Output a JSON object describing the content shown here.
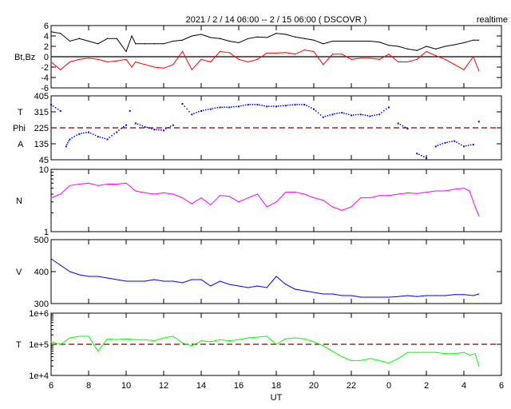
{
  "chart_data": {
    "type": "line",
    "title": "2021 / 2 / 14   06:00 --  2 / 15   06:00 ( DSCOVR )",
    "mode_label": "realtime",
    "xlabel": "UT",
    "x_unit": "hours since 2021-02-14 00:00",
    "xlim": [
      6,
      30
    ],
    "xticks": [
      6,
      8,
      10,
      12,
      14,
      16,
      18,
      20,
      22,
      24,
      26,
      28,
      30
    ],
    "xtick_labels": [
      "6",
      "8",
      "10",
      "12",
      "14",
      "16",
      "18",
      "20",
      "22",
      "0",
      "2",
      "4",
      "6"
    ],
    "colors": {
      "bt": "#000000",
      "bz": "#ff0000",
      "phi": "#0000ff",
      "n": "#ff00ff",
      "v": "#0000ff",
      "t": "#00ff00",
      "ref": "#800000"
    },
    "panels": [
      {
        "id": "bt-bz",
        "ylabel": "Bt,Bz",
        "scale": "linear",
        "ylim": [
          -6,
          6
        ],
        "yticks": [
          -6,
          -4,
          -2,
          0,
          2,
          4,
          6
        ],
        "ytick_labels": [
          "-6",
          "-4",
          "-2",
          "0",
          "2",
          "4",
          "6"
        ],
        "ref_line": {
          "value": 0,
          "style": "solid"
        },
        "series": [
          {
            "name": "Bt",
            "color_key": "bt",
            "x": [
              6,
              6.5,
              7,
              7.5,
              8,
              8.5,
              9,
              9.5,
              10,
              10.3,
              10.5,
              11,
              11.5,
              12,
              12.5,
              13,
              13.5,
              14,
              14.5,
              15,
              15.5,
              16,
              16.5,
              17,
              17.5,
              18,
              18.5,
              19,
              19.5,
              20,
              20.5,
              21,
              21.5,
              22,
              22.5,
              23,
              23.5,
              24,
              24.5,
              25,
              25.5,
              26,
              26.5,
              27,
              27.5,
              28,
              28.5,
              28.8
            ],
            "y": [
              4.8,
              4.5,
              3,
              3.5,
              3,
              2.5,
              3.5,
              3.5,
              1,
              4,
              2.5,
              2.5,
              2.5,
              2.5,
              3,
              3.2,
              4,
              4.3,
              3.7,
              3.5,
              3,
              2.7,
              3.5,
              3.8,
              3.7,
              4.5,
              4.3,
              3.8,
              3.5,
              3.2,
              2.5,
              3,
              3,
              3,
              3,
              3,
              2.8,
              2.2,
              2,
              1.5,
              1.2,
              2,
              1.5,
              2,
              2.3,
              2.7,
              3.2,
              3.2
            ]
          },
          {
            "name": "Bz",
            "color_key": "bz",
            "x": [
              6,
              6.5,
              7,
              7.5,
              8,
              8.5,
              9,
              9.5,
              10,
              10.3,
              10.5,
              11,
              11.5,
              12,
              12.5,
              13,
              13.5,
              14,
              14.5,
              15,
              15.5,
              16,
              16.5,
              17,
              17.5,
              18,
              18.5,
              19,
              19.5,
              20,
              20.5,
              21,
              21.5,
              22,
              22.5,
              23,
              23.5,
              24,
              24.5,
              25,
              25.5,
              26,
              26.5,
              27,
              27.5,
              28,
              28.5,
              28.8
            ],
            "y": [
              -1,
              -2.5,
              -1,
              -0.5,
              -0.3,
              -0.5,
              -1,
              -0.8,
              -0.5,
              -2,
              -1,
              -1.5,
              -2,
              -2.2,
              -1.5,
              1,
              -2.5,
              -0.5,
              -1,
              1,
              0.8,
              -0.5,
              -1,
              -0.5,
              0.7,
              0.7,
              0.8,
              0.5,
              1.3,
              1,
              -1.5,
              0.5,
              0.5,
              -0.5,
              -0.3,
              -0.3,
              -0.5,
              0.5,
              -1,
              -1,
              -0.5,
              1,
              0.2,
              -0.5,
              -1.5,
              -2.5,
              0,
              -2.7
            ]
          }
        ]
      },
      {
        "id": "phi",
        "ylabel_lines": [
          "T",
          "Phi",
          "A"
        ],
        "scale": "linear",
        "ylim": [
          45,
          405
        ],
        "yticks": [
          45,
          135,
          225,
          315,
          405
        ],
        "ytick_labels": [
          "45",
          "135",
          "225",
          "315",
          "405"
        ],
        "ref_line": {
          "value": 225,
          "style": "dashed"
        },
        "series": [
          {
            "name": "Phi",
            "color_key": "phi",
            "plot": "scatter",
            "x": [
              6,
              6.5,
              6.8,
              7,
              7.5,
              8,
              8.5,
              9,
              9.5,
              10,
              10.2,
              10.5,
              11,
              11.5,
              12,
              12.5,
              13,
              13.5,
              14,
              14.5,
              15,
              15.5,
              16,
              16.5,
              17,
              17.5,
              18,
              18.5,
              19,
              19.5,
              20,
              20.5,
              21,
              21.5,
              22,
              22.5,
              23,
              23.5,
              24,
              24.5,
              25,
              25.5,
              26,
              26.5,
              27,
              27.5,
              28,
              28.5,
              28.8
            ],
            "y": [
              355,
              320,
              120,
              160,
              190,
              200,
              175,
              160,
              200,
              240,
              320,
              250,
              230,
              215,
              210,
              240,
              360,
              300,
              320,
              330,
              340,
              340,
              345,
              355,
              355,
              345,
              345,
              350,
              355,
              355,
              330,
              285,
              300,
              310,
              295,
              300,
              290,
              300,
              340,
              250,
              220,
              80,
              55,
              120,
              140,
              150,
              120,
              130,
              260
            ]
          }
        ]
      },
      {
        "id": "density",
        "ylabel": "N",
        "scale": "log",
        "ylim": [
          1,
          10
        ],
        "yticks": [
          1,
          10
        ],
        "ytick_labels": [
          "1",
          "10"
        ],
        "series": [
          {
            "name": "N",
            "color_key": "n",
            "x": [
              6,
              6.5,
              7,
              7.5,
              8,
              8.5,
              9,
              9.5,
              10,
              10.5,
              11,
              11.5,
              12,
              12.5,
              13,
              13.5,
              14,
              14.5,
              15,
              15.5,
              16,
              16.5,
              17,
              17.5,
              18,
              18.5,
              19,
              19.5,
              20,
              20.5,
              21,
              21.5,
              22,
              22.5,
              23,
              23.5,
              24,
              24.5,
              25,
              25.5,
              26,
              26.5,
              27,
              27.5,
              28,
              28.3,
              28.6,
              28.8
            ],
            "y": [
              3.5,
              4,
              5.5,
              5.8,
              6,
              5.5,
              5.8,
              5.8,
              6,
              4.5,
              4.2,
              4,
              4.2,
              4,
              3.5,
              2.8,
              3.5,
              2.7,
              3.8,
              3.7,
              3,
              3.5,
              4,
              2.5,
              3,
              4.3,
              4.3,
              4,
              3.5,
              3.2,
              2.5,
              2.2,
              2.5,
              3.5,
              3.5,
              3.8,
              3.8,
              4,
              4.2,
              4.1,
              4.3,
              4.5,
              4.5,
              4.8,
              5,
              4.5,
              2.5,
              1.8
            ]
          }
        ]
      },
      {
        "id": "speed",
        "ylabel": "V",
        "scale": "linear",
        "ylim": [
          300,
          500
        ],
        "yticks": [
          300,
          400,
          500
        ],
        "ytick_labels": [
          "300",
          "400",
          "500"
        ],
        "series": [
          {
            "name": "V",
            "color_key": "v",
            "x": [
              6,
              6.5,
              7,
              7.5,
              8,
              8.5,
              9,
              9.5,
              10,
              10.5,
              11,
              11.5,
              12,
              12.5,
              13,
              13.5,
              14,
              14.5,
              15,
              15.5,
              16,
              16.5,
              17,
              17.5,
              18,
              18.5,
              19,
              19.5,
              20,
              20.5,
              21,
              21.5,
              22,
              22.5,
              23,
              23.5,
              24,
              24.5,
              25,
              25.5,
              26,
              26.5,
              27,
              27.5,
              28,
              28.5,
              28.8
            ],
            "y": [
              440,
              420,
              400,
              390,
              385,
              385,
              380,
              375,
              370,
              370,
              370,
              375,
              370,
              370,
              365,
              375,
              375,
              355,
              370,
              360,
              355,
              350,
              355,
              350,
              385,
              360,
              345,
              340,
              335,
              330,
              330,
              325,
              325,
              320,
              320,
              320,
              320,
              322,
              325,
              322,
              325,
              325,
              325,
              328,
              328,
              325,
              330
            ]
          }
        ]
      },
      {
        "id": "temperature",
        "ylabel": "T",
        "scale": "log",
        "ylim": [
          10000,
          1000000
        ],
        "yticks": [
          10000,
          100000,
          1000000
        ],
        "ytick_labels": [
          "1e+4",
          "1e+5",
          "1e+6"
        ],
        "ref_line": {
          "value": 100000,
          "style": "dashed"
        },
        "series": [
          {
            "name": "T",
            "color_key": "t",
            "x": [
              6,
              6.5,
              7,
              7.5,
              8,
              8.5,
              9,
              9.5,
              10,
              10.5,
              11,
              11.5,
              12,
              12.5,
              13,
              13.5,
              14,
              14.5,
              15,
              15.5,
              16,
              16.5,
              17,
              17.5,
              18,
              18.5,
              19,
              19.5,
              20,
              20.5,
              21,
              21.5,
              22,
              22.5,
              23,
              23.5,
              24,
              24.5,
              25,
              25.5,
              26,
              26.5,
              27,
              27.5,
              28,
              28.3,
              28.6,
              28.8
            ],
            "y": [
              120000,
              100000,
              160000,
              180000,
              180000,
              60000,
              150000,
              140000,
              150000,
              140000,
              140000,
              130000,
              160000,
              180000,
              110000,
              90000,
              130000,
              120000,
              140000,
              130000,
              140000,
              160000,
              170000,
              180000,
              100000,
              150000,
              160000,
              150000,
              120000,
              90000,
              60000,
              40000,
              30000,
              30000,
              35000,
              30000,
              25000,
              35000,
              55000,
              55000,
              55000,
              55000,
              50000,
              50000,
              55000,
              45000,
              50000,
              20000
            ]
          }
        ]
      }
    ]
  }
}
